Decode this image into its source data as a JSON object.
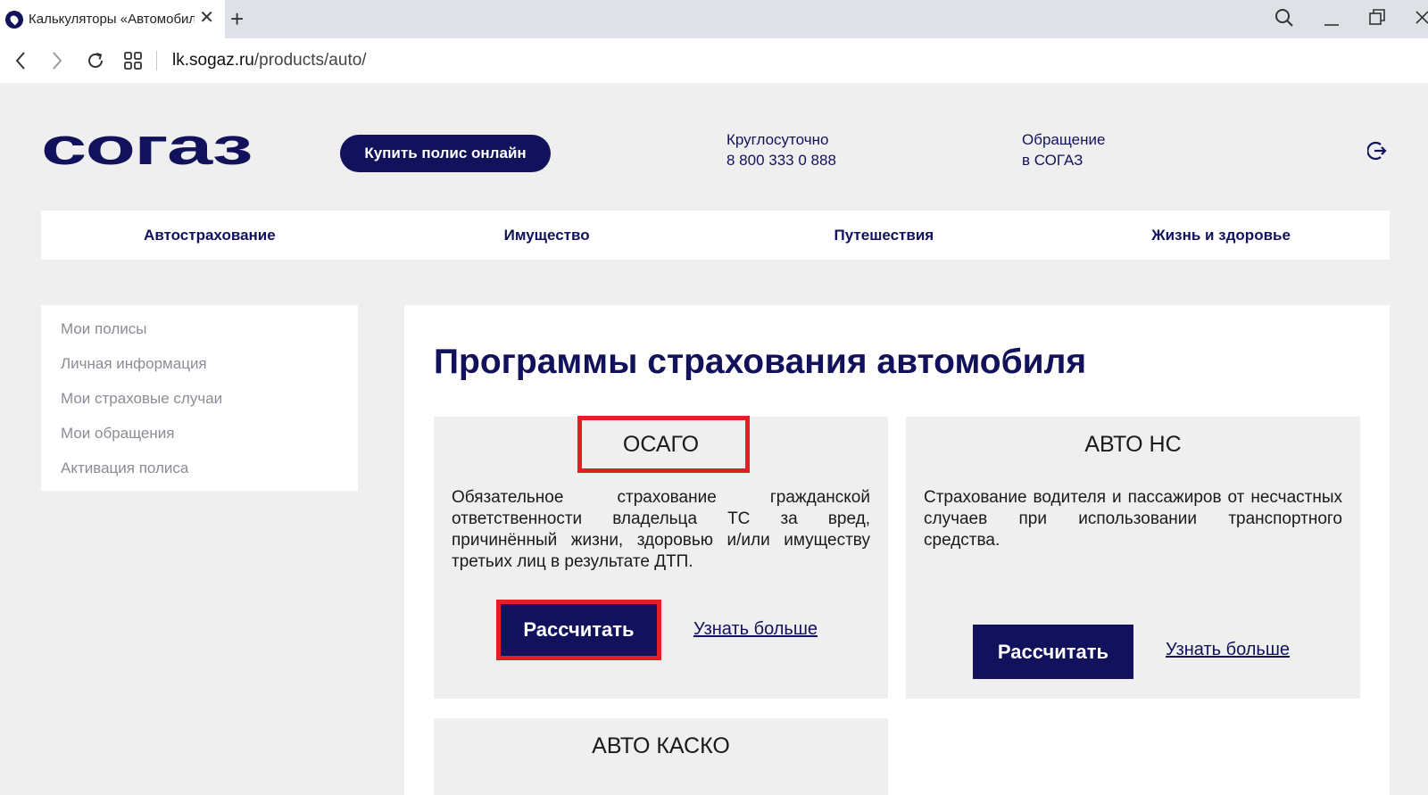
{
  "browser": {
    "tab_title": "Калькуляторы «Автомобиль»",
    "new_tab": "+",
    "url_host": "lk.sogaz.ru",
    "url_path": "/products/auto/"
  },
  "header": {
    "logo_text": "СОГАЗ",
    "buy_button": "Купить полис онлайн",
    "phone_label": "Круглосуточно",
    "phone_number": "8 800 333 0 888",
    "appeal_line1": "Обращение",
    "appeal_line2": "в СОГАЗ"
  },
  "mainnav": {
    "items": [
      {
        "label": "Автострахование"
      },
      {
        "label": "Имущество"
      },
      {
        "label": "Путешествия"
      },
      {
        "label": "Жизнь и здоровье"
      }
    ]
  },
  "sidebar": {
    "items": [
      {
        "label": "Мои полисы"
      },
      {
        "label": "Личная информация"
      },
      {
        "label": "Мои страховые случаи"
      },
      {
        "label": "Мои обращения"
      },
      {
        "label": "Активация полиса"
      }
    ]
  },
  "main": {
    "title": "Программы страхования автомобиля",
    "cards": [
      {
        "title": "ОСАГО",
        "description": "Обязательное страхование гражданской ответственности владельца ТС за вред, причинённый жизни, здоровью и/или имуществу третьих лиц в результате ДТП.",
        "calc_label": "Рассчитать",
        "more_label": "Узнать больше"
      },
      {
        "title": "АВТО НС",
        "description": "Страхование водителя и пассажиров от несчастных случаев при использовании транспортного средства.",
        "calc_label": "Рассчитать",
        "more_label": "Узнать больше"
      },
      {
        "title": "АВТО КАСКО"
      }
    ]
  },
  "colors": {
    "brand": "#12125c",
    "highlight": "#e31e24",
    "background": "#efefef"
  }
}
